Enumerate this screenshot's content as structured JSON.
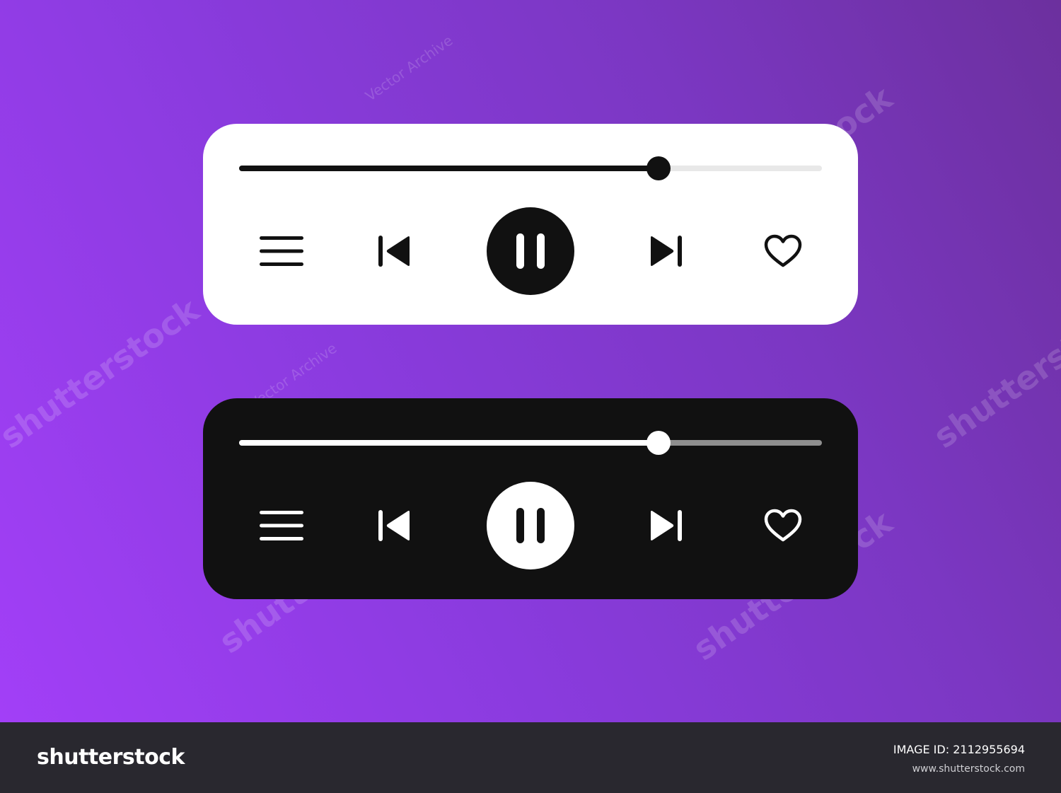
{
  "colors": {
    "background_gradient": [
      "#a23ff7",
      "#6c309e"
    ],
    "light_card": "#ffffff",
    "dark_card": "#111111",
    "light_track": "#e8e8e8",
    "dark_track": "#8f8f8f",
    "footer": "#29282f"
  },
  "players": [
    {
      "theme": "light",
      "progress": 0.72,
      "controls": {
        "menu_icon": "hamburger-menu-icon",
        "previous_icon": "skip-previous-icon",
        "play_pause_icon": "pause-icon",
        "next_icon": "skip-next-icon",
        "favorite_icon": "heart-outline-icon"
      }
    },
    {
      "theme": "dark",
      "progress": 0.72,
      "controls": {
        "menu_icon": "hamburger-menu-icon",
        "previous_icon": "skip-previous-icon",
        "play_pause_icon": "pause-icon",
        "next_icon": "skip-next-icon",
        "favorite_icon": "heart-outline-icon"
      }
    }
  ],
  "watermarks": {
    "brand": "shutterstock",
    "contributor": "Vector Archive"
  },
  "footer": {
    "logo": "shutterstock",
    "image_id_label": "IMAGE ID:",
    "image_id": "2112955694",
    "url": "www.shutterstock.com"
  }
}
